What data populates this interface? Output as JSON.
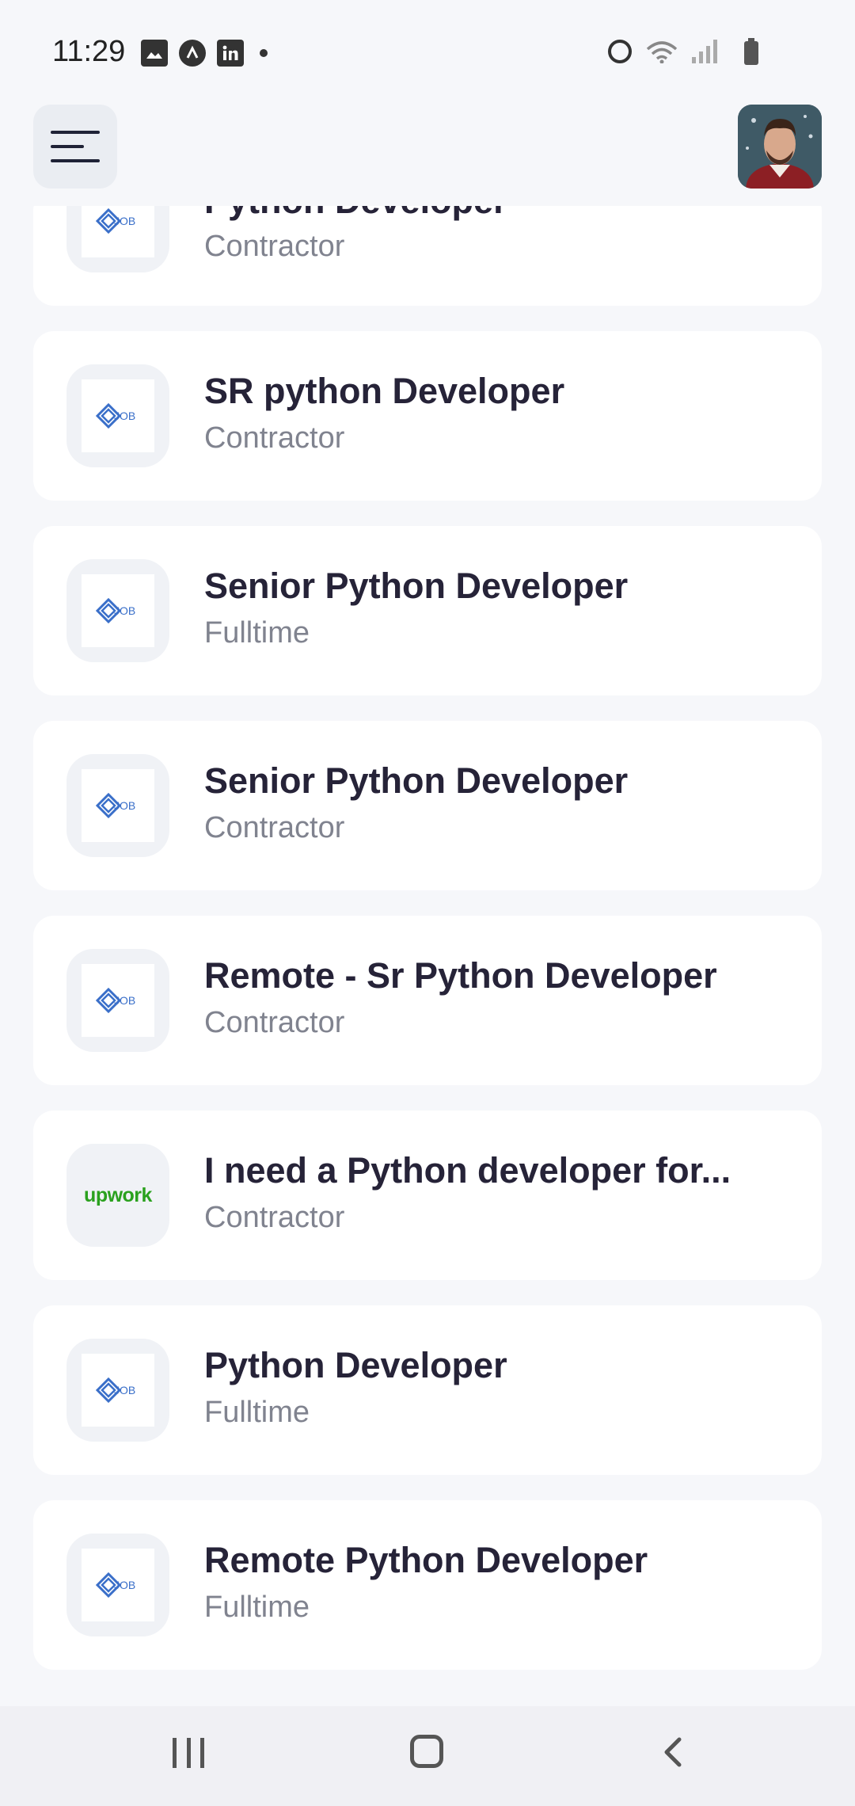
{
  "status_bar": {
    "time": "11:29",
    "left_icons": [
      "gallery-icon",
      "app-icon",
      "linkedin-icon"
    ],
    "right_icons": [
      "alarm-icon",
      "wifi-icon",
      "signal-icon",
      "battery-icon"
    ]
  },
  "header": {
    "menu_icon": "hamburger-menu-icon",
    "avatar": "profile-avatar"
  },
  "jobs": [
    {
      "title": "Python Developer",
      "type": "Contractor",
      "logo": "job-logo"
    },
    {
      "title": "SR python Developer",
      "type": "Contractor",
      "logo": "job-logo"
    },
    {
      "title": "Senior Python Developer",
      "type": "Fulltime",
      "logo": "job-logo"
    },
    {
      "title": "Senior Python Developer",
      "type": "Contractor",
      "logo": "job-logo"
    },
    {
      "title": "Remote - Sr Python Developer",
      "type": "Contractor",
      "logo": "job-logo"
    },
    {
      "title": "I need a Python developer for...",
      "type": "Contractor",
      "logo": "upwork",
      "logo_text": "upwork"
    },
    {
      "title": "Python Developer",
      "type": "Fulltime",
      "logo": "job-logo"
    },
    {
      "title": "Remote Python Developer",
      "type": "Fulltime",
      "logo": "job-logo"
    }
  ],
  "nav": {
    "recent_icon": "recent-apps-icon",
    "home_icon": "home-icon",
    "back_icon": "back-icon"
  },
  "colors": {
    "background": "#f6f7fa",
    "card": "#ffffff",
    "title": "#262338",
    "subtitle": "#80838f",
    "job_logo_blue": "#3a6fc9",
    "upwork_green": "#2aa11e"
  }
}
